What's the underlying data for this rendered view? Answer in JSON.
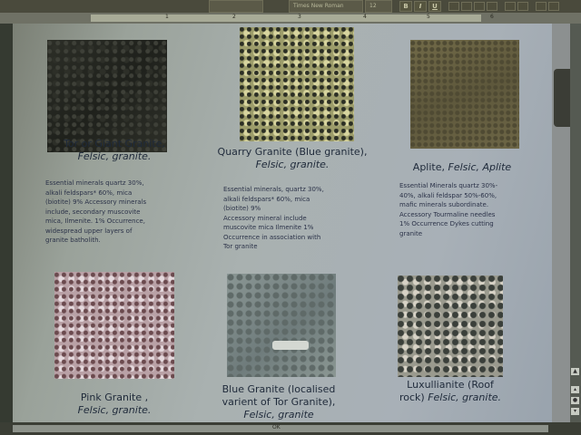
{
  "toolbar": {
    "font_name": "Times New Roman",
    "font_size": "12",
    "bold": "B",
    "italic": "I",
    "underline": "U"
  },
  "ruler": {
    "numbers": [
      "1",
      "2",
      "3",
      "4",
      "5",
      "6"
    ]
  },
  "status": {
    "label": "OK"
  },
  "cards": [
    {
      "title": "Tor or Giant Granite,",
      "subtitle": "Felsic, granite.",
      "lines": [
        "Essential minerals quartz 30%,",
        "alkali feldspars* 60%, mica",
        "(biotite) 9% Accessory minerals",
        "include, secondary muscovite",
        "mica, Ilmenite. 1% Occurrence,",
        "widespread upper layers of",
        "granite batholith."
      ]
    },
    {
      "title": "Quarry Granite (Blue granite),",
      "subtitle": "Felsic, granite.",
      "lines": [
        "Essential minerals, quartz 30%,",
        "alkali feldspars* 60%, mica",
        "(biotite) 9%",
        "Accessory mineral include",
        "muscovite mica Ilmenite 1%",
        "Occurrence in association with",
        "Tor granite"
      ]
    },
    {
      "title": "Aplite,",
      "title_italic": "Felsic, Aplite",
      "lines": [
        "Essential Minerals quartz 30%-",
        "40%, alkali feldspar 50%-60%,",
        "mafic minerals subordinate.",
        "Accessory Tourmaline needles",
        "1% Occurrence Dykes cutting",
        "granite"
      ]
    },
    {
      "title": "Pink Granite ,",
      "subtitle": "Felsic, granite."
    },
    {
      "title": "Blue Granite (localised",
      "title2": "varient of Tor Granite),",
      "subtitle": "Felsic, granite"
    },
    {
      "title": "Luxullianite (Roof",
      "title2": "rock)",
      "subtitle": "Felsic, granite."
    }
  ]
}
